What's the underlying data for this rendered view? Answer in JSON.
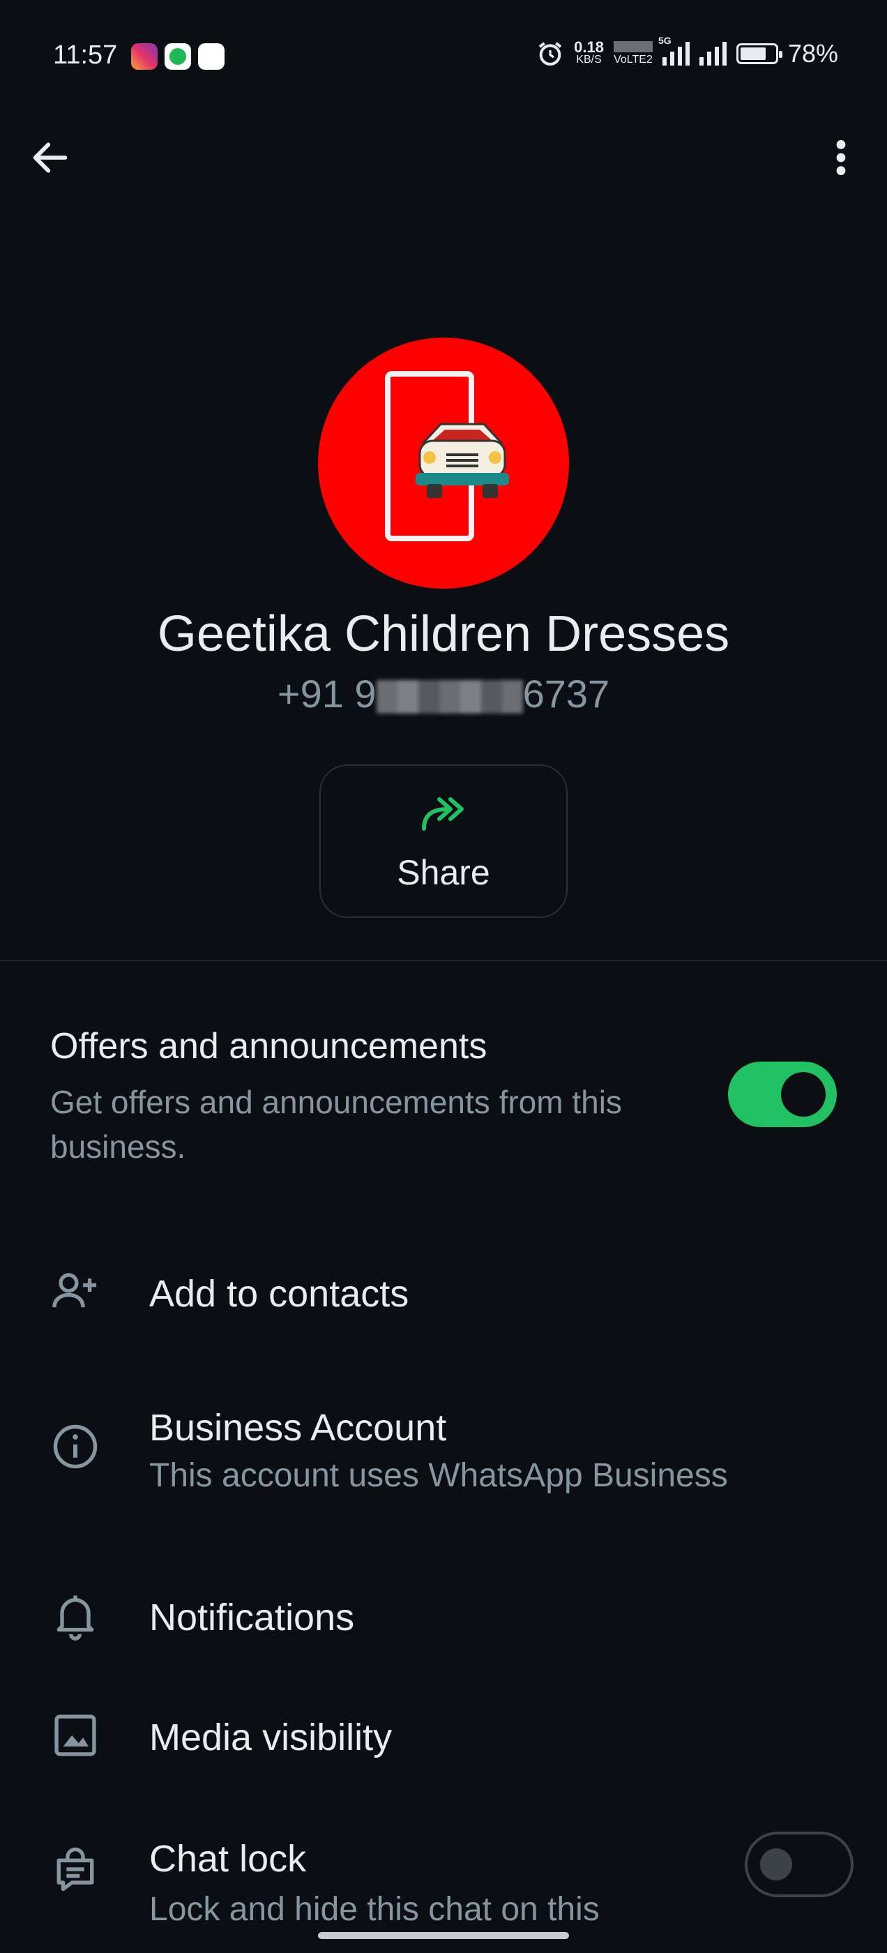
{
  "status_bar": {
    "time": "11:57",
    "speed_value": "0.18",
    "speed_unit": "KB/S",
    "volte": "VoLTE2",
    "network": "5G",
    "battery": "78%",
    "battery_level": 0.78
  },
  "header": {
    "back_icon": "arrow-left-icon",
    "menu_icon": "more-vert-icon"
  },
  "profile": {
    "name": "Geetika Children Dresses",
    "phone_prefix": "+91 9",
    "phone_suffix": "6737",
    "share_label": "Share"
  },
  "offers": {
    "title": "Offers and announcements",
    "subtitle": "Get offers and announcements from this business.",
    "enabled": true
  },
  "rows": {
    "add_contacts": {
      "title": "Add to contacts",
      "icon": "person-add-icon"
    },
    "business": {
      "title": "Business Account",
      "subtitle": "This account uses WhatsApp Business",
      "icon": "info-icon"
    },
    "notifications": {
      "title": "Notifications",
      "icon": "bell-icon"
    },
    "media": {
      "title": "Media visibility",
      "icon": "image-icon"
    },
    "chat_lock": {
      "title": "Chat lock",
      "subtitle": "Lock and hide this chat on this",
      "icon": "chat-lock-icon",
      "enabled": false
    }
  },
  "colors": {
    "background": "#0b0f13",
    "accent": "#21c063",
    "avatar_bg": "#ff0000",
    "secondary_text": "#8696a0"
  }
}
